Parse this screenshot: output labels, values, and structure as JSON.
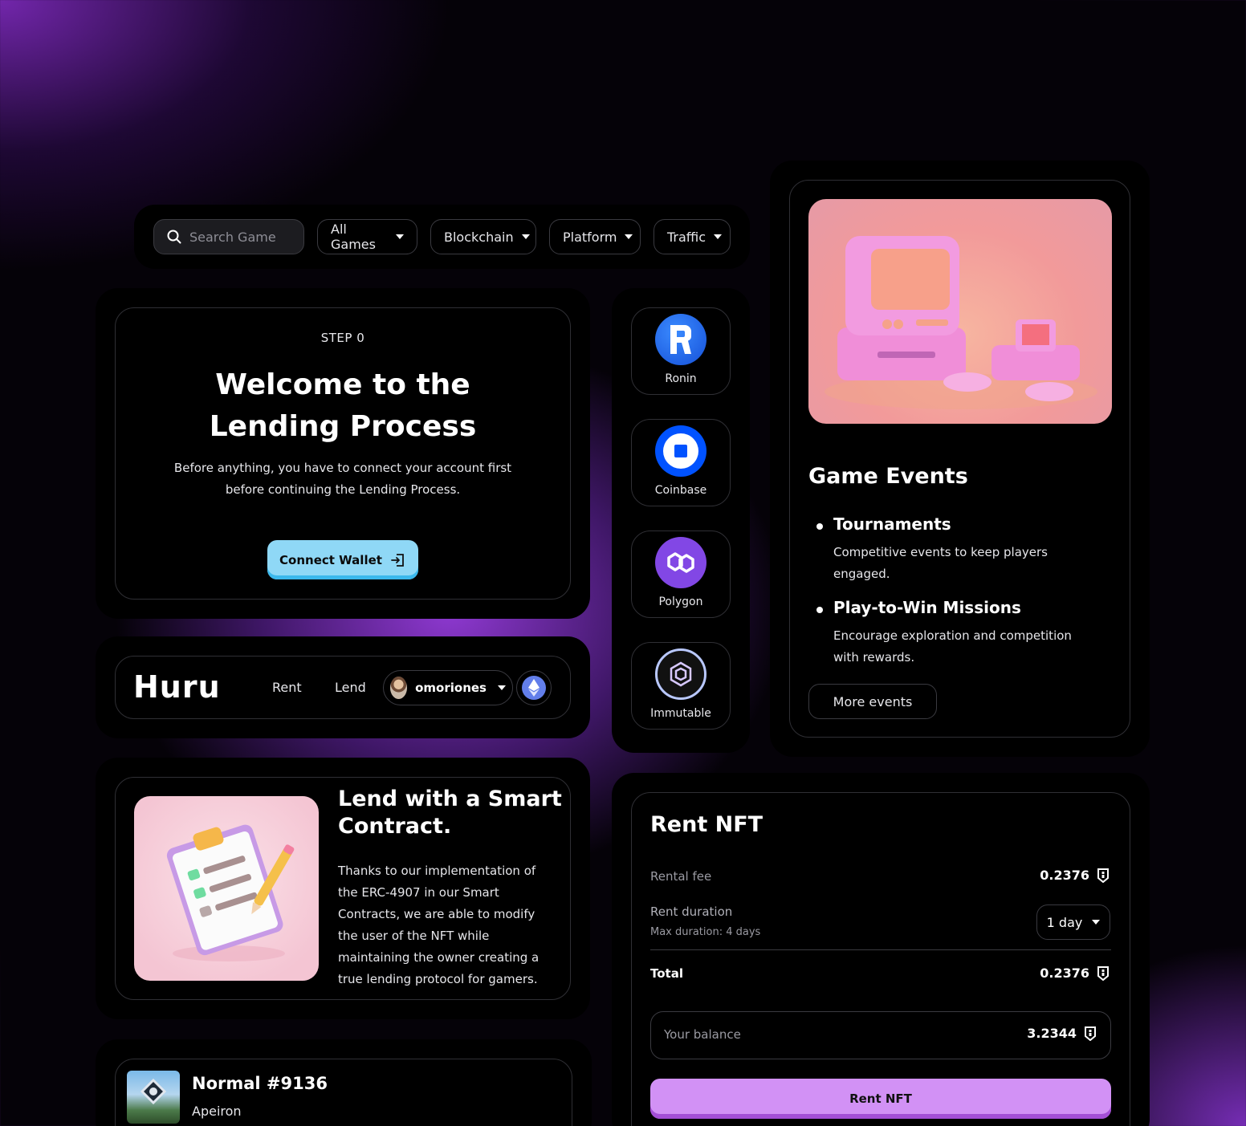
{
  "filters": {
    "search_placeholder": "Search Game",
    "dropdowns": [
      "All Games",
      "Blockchain",
      "Platform",
      "Traffic"
    ]
  },
  "step_card": {
    "step": "STEP 0",
    "title": "Welcome to the Lending Process",
    "description": "Before anything, you have to connect your account first before continuing the Lending Process.",
    "button": "Connect Wallet"
  },
  "wallets": [
    {
      "name": "Ronin",
      "color": "#2a6ef5"
    },
    {
      "name": "Coinbase",
      "color": "#0052ff"
    },
    {
      "name": "Polygon",
      "color": "#8247e5"
    },
    {
      "name": "Immutable",
      "color": "#14141a"
    }
  ],
  "navbar": {
    "brand": "Huru",
    "links": [
      "Rent",
      "Lend"
    ],
    "username": "omoriones"
  },
  "lend_card": {
    "title": "Lend with a Smart Contract.",
    "description": "Thanks to our implementation of the ERC-4907 in our Smart Contracts, we are able to modify the user of the NFT while maintaining the owner creating a true lending protocol for gamers."
  },
  "nft_card": {
    "title": "Normal #9136",
    "collection": "Apeiron"
  },
  "game_events": {
    "title": "Game Events",
    "items": [
      {
        "title": "Tournaments",
        "description": "Competitive events to keep players engaged."
      },
      {
        "title": "Play-to-Win Missions",
        "description": "Encourage exploration and competition with rewards."
      }
    ],
    "more_button": "More events"
  },
  "rent_nft": {
    "title": "Rent NFT",
    "rental_fee_label": "Rental fee",
    "rental_fee_value": "0.2376",
    "duration_label": "Rent duration",
    "duration_hint": "Max duration: 4 days",
    "duration_value": "1 day",
    "total_label": "Total",
    "total_value": "0.2376",
    "balance_label": "Your balance",
    "balance_value": "3.2344",
    "button": "Rent NFT"
  },
  "colors": {
    "accent_cyan": "#8fd8f6",
    "accent_purple": "#d291f5",
    "background_glow": "#9a3ce0"
  }
}
